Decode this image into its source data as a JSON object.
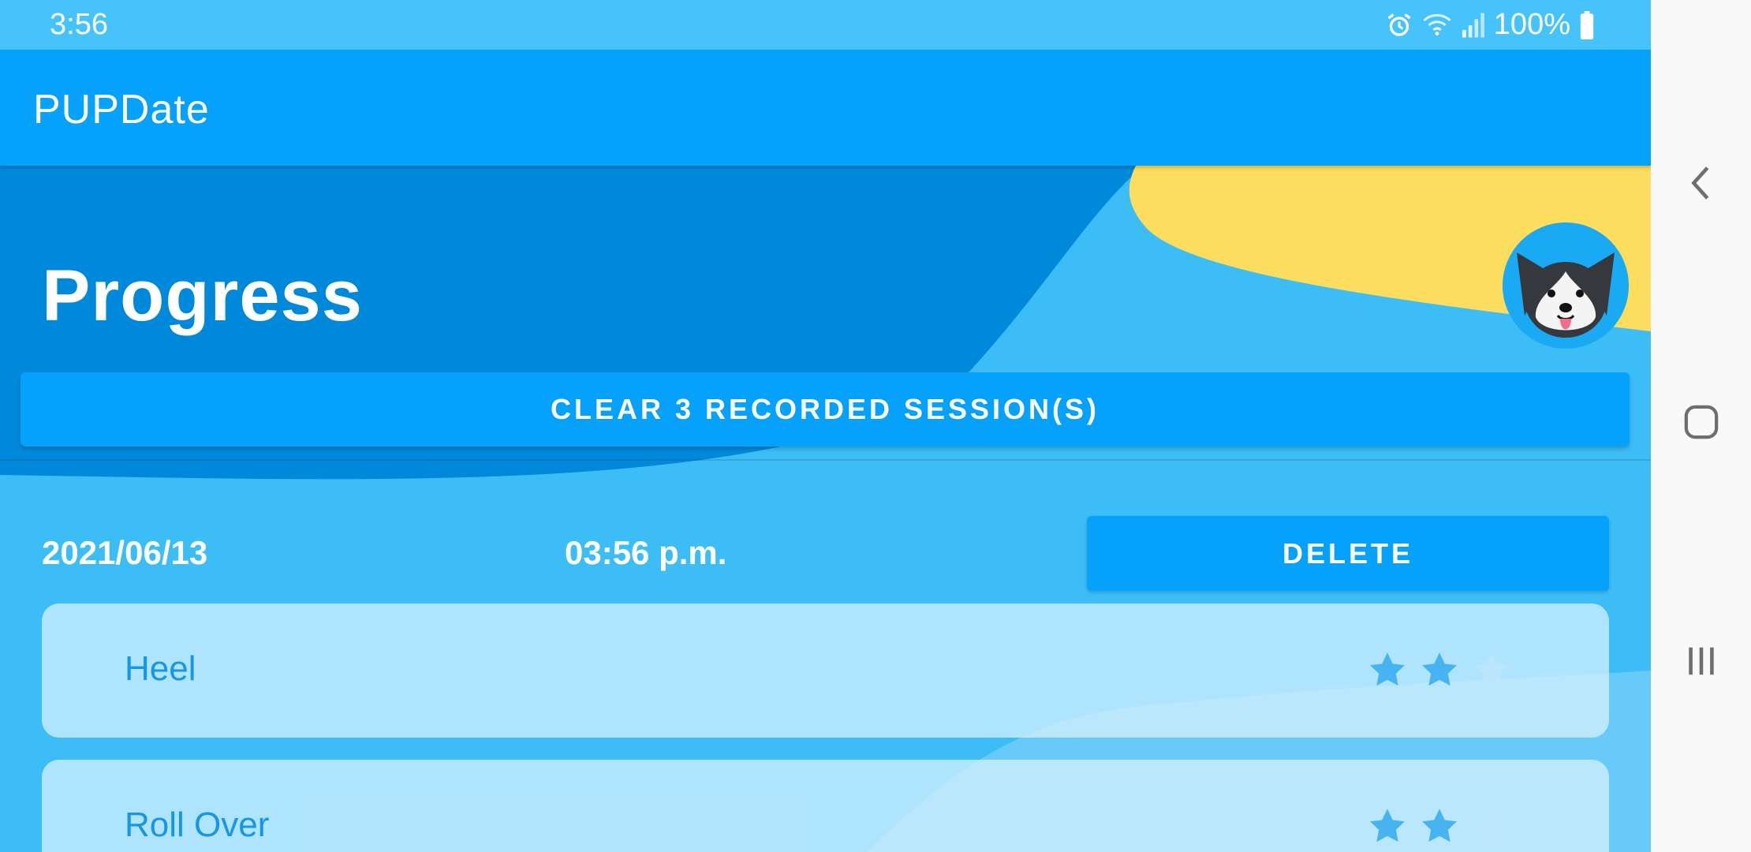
{
  "status_bar": {
    "time": "3:56",
    "battery": "100%",
    "icons": [
      "alarm-icon",
      "wifi-icon",
      "signal-icon",
      "battery-icon"
    ]
  },
  "app_bar": {
    "title": "PUPDate"
  },
  "header": {
    "title": "Progress",
    "avatar": "dog-avatar"
  },
  "actions": {
    "clear_label": "CLEAR 3 RECORDED SESSION(S)",
    "delete_label": "DELETE"
  },
  "session": {
    "date": "2021/06/13",
    "time": "03:56 p.m.",
    "items": [
      {
        "label": "Heel",
        "rating": 2,
        "max_rating": 3
      },
      {
        "label": "Roll Over",
        "rating": 2,
        "max_rating": 3
      }
    ]
  },
  "nav": {
    "buttons": [
      "back-icon",
      "home-icon",
      "recents-icon"
    ]
  },
  "colors": {
    "app_bar": "#05a1fb",
    "header_dark": "#0089db",
    "background": "#3cbdf6",
    "accent_yellow": "#fddd5d",
    "card": "#c6ecfd",
    "label": "#1696e3"
  }
}
